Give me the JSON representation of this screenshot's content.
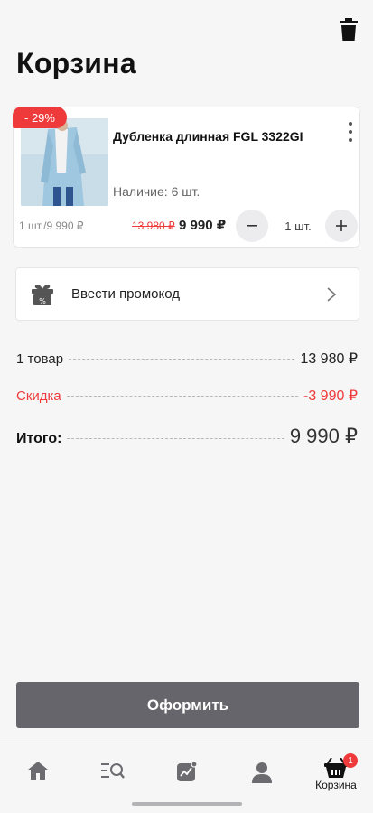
{
  "header": {
    "title": "Корзина"
  },
  "cart_item": {
    "discount_badge": "- 29%",
    "name": "Дубленка длинная FGL 3322GI",
    "stock": "Наличие: 6 шт.",
    "unit_price": "1 шт./9 990 ₽",
    "old_price": "13 980 ₽",
    "new_price": "9 990 ₽",
    "quantity": "1 шт."
  },
  "promo": {
    "label": "Ввести промокод"
  },
  "summary": {
    "items_label": "1 товар",
    "items_value": "13 980 ₽",
    "discount_label": "Скидка",
    "discount_value": "-3 990 ₽",
    "total_label": "Итого:",
    "total_value": "9 990 ₽"
  },
  "checkout": {
    "label": "Оформить"
  },
  "bottom_nav": {
    "items": [
      {
        "icon": "home-icon"
      },
      {
        "icon": "catalog-search-icon"
      },
      {
        "icon": "promo-chart-icon"
      },
      {
        "icon": "profile-icon"
      },
      {
        "icon": "cart-icon",
        "label": "Корзина",
        "badge": "1"
      }
    ]
  },
  "colors": {
    "accent_red": "#ee3a3a",
    "checkout_button": "#65656b",
    "background": "#f6f6f7"
  }
}
